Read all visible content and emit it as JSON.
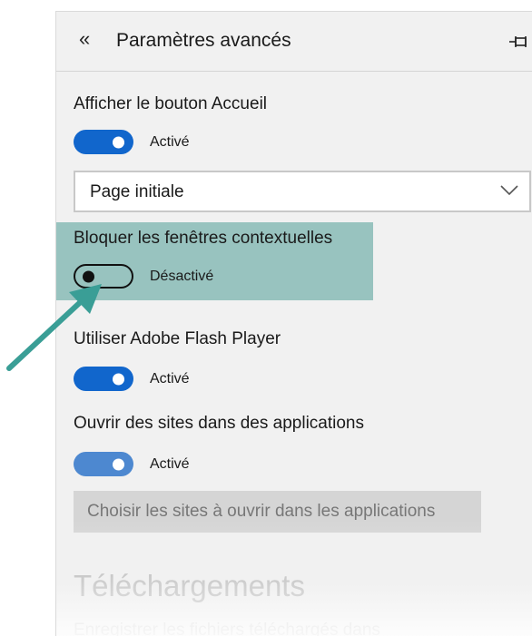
{
  "panel": {
    "title": "Paramètres avancés",
    "back_icon": "double-chevron-left-icon",
    "back_glyph": "«",
    "pin_icon": "pin-icon"
  },
  "settings": {
    "home_button": {
      "label": "Afficher le bouton Accueil",
      "toggle_state": "Activé",
      "enabled": true,
      "dropdown_value": "Page initiale"
    },
    "popups": {
      "label": "Bloquer les fenêtres contextuelles",
      "toggle_state": "Désactivé",
      "enabled": false
    },
    "flash": {
      "label": "Utiliser Adobe Flash Player",
      "toggle_state": "Activé",
      "enabled": true
    },
    "open_in_apps": {
      "label": "Ouvrir des sites dans des applications",
      "toggle_state": "Activé",
      "enabled": true,
      "button_label": "Choisir les sites à ouvrir dans les applications"
    }
  },
  "downloads": {
    "heading": "Téléchargements",
    "description": "Enregistrer les fichiers téléchargés dans"
  },
  "colors": {
    "toggle_on": "#1166cc",
    "highlight": "#98c3bf",
    "arrow": "#3a9e96"
  }
}
